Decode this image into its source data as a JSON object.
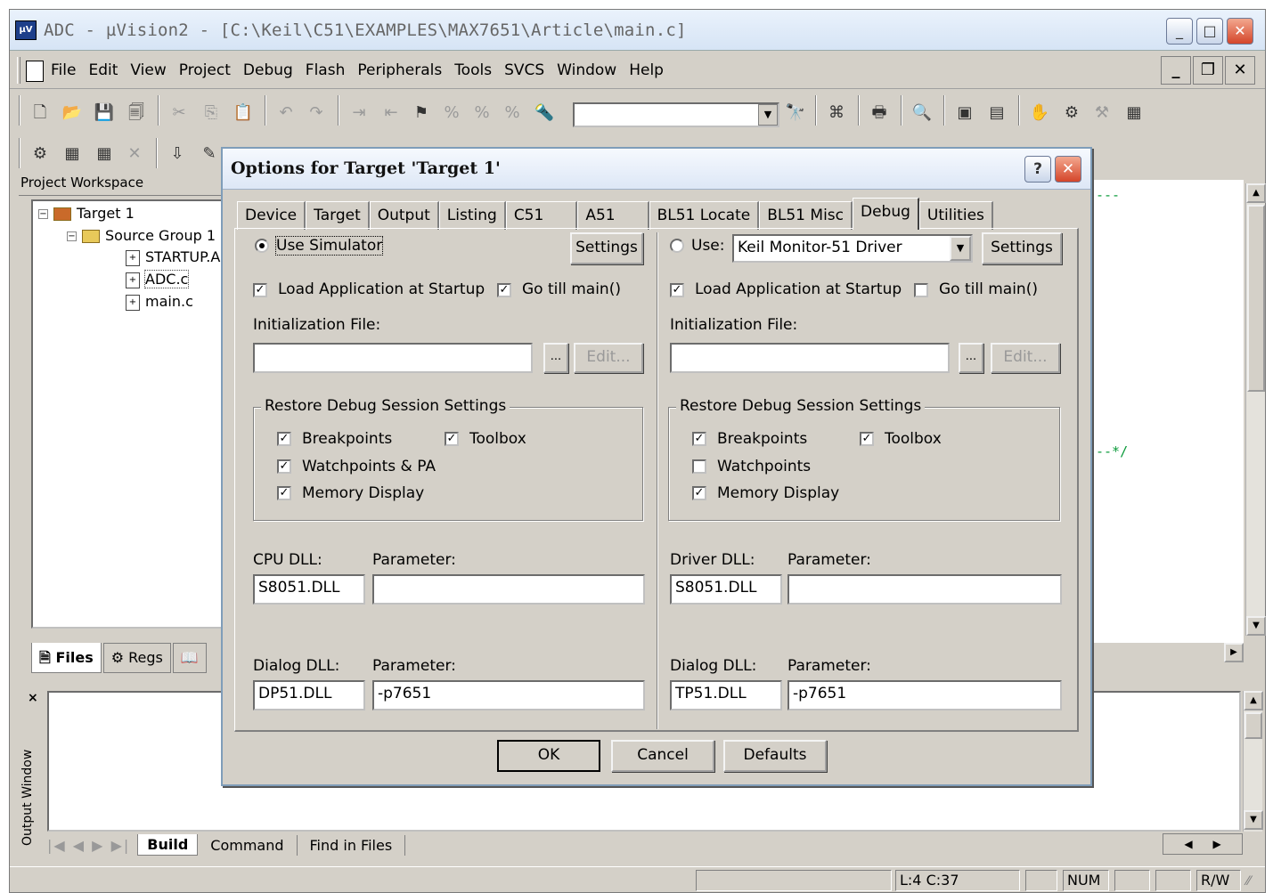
{
  "window": {
    "title": "ADC  - µVision2 - [C:\\Keil\\C51\\EXAMPLES\\MAX7651\\Article\\main.c]",
    "app_icon": "keil-icon"
  },
  "menu": [
    "File",
    "Edit",
    "View",
    "Project",
    "Debug",
    "Flash",
    "Peripherals",
    "Tools",
    "SVCS",
    "Window",
    "Help"
  ],
  "workspace": {
    "title": "Project Workspace",
    "tree": {
      "target": "Target 1",
      "group": "Source Group 1",
      "files": [
        "STARTUP.A",
        "ADC.c",
        "main.c"
      ]
    },
    "tabs": [
      "Files",
      "Regs",
      "Books"
    ]
  },
  "editor": {
    "snippet1": "---",
    "snippet2": "--*/"
  },
  "output": {
    "label": "Output Window",
    "tabs": [
      "Build",
      "Command",
      "Find in Files"
    ]
  },
  "status": {
    "pos": "L:4 C:37",
    "num": "NUM",
    "rw": "R/W"
  },
  "dialog": {
    "title": "Options for Target 'Target 1'",
    "help": "?",
    "tabs": [
      "Device",
      "Target",
      "Output",
      "Listing",
      "C51",
      "A51",
      "BL51 Locate",
      "BL51 Misc",
      "Debug",
      "Utilities"
    ],
    "active_tab": "Debug",
    "left": {
      "mode_label": "Use Simulator",
      "settings": "Settings",
      "load_app": "Load Application at Startup",
      "go_main": "Go  till main()",
      "init_label": "Initialization File:",
      "init_value": "",
      "browse": "...",
      "edit": "Edit...",
      "group": "Restore Debug Session Settings",
      "breakpoints": "Breakpoints",
      "toolbox": "Toolbox",
      "watchpoints": "Watchpoints & PA",
      "memory": "Memory Display",
      "cpu_dll_label": "CPU DLL:",
      "param_label": "Parameter:",
      "cpu_dll": "S8051.DLL",
      "cpu_param": "",
      "dialog_dll_label": "Dialog DLL:",
      "dialog_dll": "DP51.DLL",
      "dialog_param": "-p7651"
    },
    "right": {
      "mode_label": "Use:",
      "driver": "Keil Monitor-51 Driver",
      "settings": "Settings",
      "load_app": "Load Application at Startup",
      "go_main": "Go  till main()",
      "init_label": "Initialization File:",
      "init_value": "",
      "browse": "...",
      "edit": "Edit...",
      "group": "Restore Debug Session Settings",
      "breakpoints": "Breakpoints",
      "toolbox": "Toolbox",
      "watchpoints": "Watchpoints",
      "memory": "Memory Display",
      "driver_dll_label": "Driver DLL:",
      "param_label": "Parameter:",
      "driver_dll": "S8051.DLL",
      "driver_param": "",
      "dialog_dll_label": "Dialog DLL:",
      "dialog_dll": "TP51.DLL",
      "dialog_param": "-p7651"
    },
    "ok": "OK",
    "cancel": "Cancel",
    "defaults": "Defaults"
  }
}
